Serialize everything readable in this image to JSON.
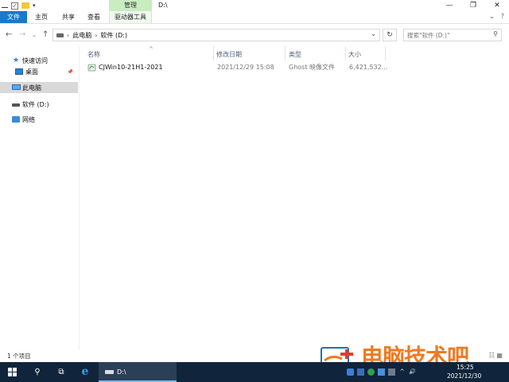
{
  "window": {
    "title": "D:\\",
    "context_tab_header": "管理",
    "controls": {
      "minimize": "—",
      "maximize": "❐",
      "close": "✕"
    }
  },
  "ribbon": {
    "tabs": [
      {
        "label": "文件",
        "active": true
      },
      {
        "label": "主页"
      },
      {
        "label": "共享"
      },
      {
        "label": "查看"
      },
      {
        "label": "驱动器工具"
      }
    ]
  },
  "address": {
    "crumbs": [
      "此电脑",
      "软件 (D:)"
    ],
    "search_placeholder": "搜索\"软件 (D:)\""
  },
  "nav_pane": {
    "items": [
      {
        "label": "快速访问",
        "icon": "star-icon"
      },
      {
        "label": "桌面",
        "icon": "desktop-icon",
        "pinned": true
      },
      {
        "label": "此电脑",
        "icon": "computer-icon",
        "selected": true
      },
      {
        "label": "软件 (D:)",
        "icon": "drive-icon"
      },
      {
        "label": "网络",
        "icon": "network-icon"
      }
    ]
  },
  "file_list": {
    "columns": {
      "name": "名称",
      "date": "修改日期",
      "type": "类型",
      "size": "大小"
    },
    "rows": [
      {
        "name": "CJWin10-21H1-2021",
        "date": "2021/12/29 15:08",
        "type": "Ghost 映像文件",
        "size": "6,421,532..."
      }
    ]
  },
  "status": {
    "item_count": "1 个项目"
  },
  "watermark": {
    "text": "电脑技术吧"
  },
  "taskbar": {
    "explorer_label": "D:\\",
    "time": "15:25",
    "date": "2021/12/30"
  },
  "colors": {
    "file_tab": "#1979ca",
    "manage_tab": "#c9ecc0",
    "taskbar": "#10243b",
    "watermark": "#ee7a21"
  }
}
